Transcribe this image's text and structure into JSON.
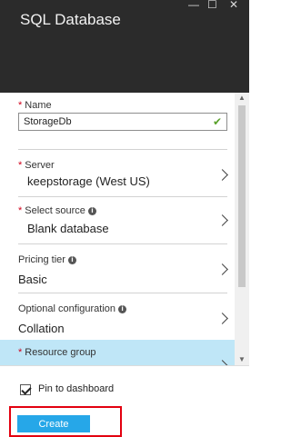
{
  "header": {
    "title": "SQL Database",
    "controls": {
      "minimize": "—",
      "maximize": "☐",
      "close": "✕"
    }
  },
  "form": {
    "name": {
      "label": "Name",
      "value": "StorageDb",
      "required": true
    },
    "server": {
      "label": "Server",
      "value": "keepstorage (West US)",
      "required": true
    },
    "select_source": {
      "label": "Select source",
      "value": "Blank database",
      "required": true
    },
    "pricing_tier": {
      "label": "Pricing tier",
      "value": "Basic",
      "required": false
    },
    "optional_configuration": {
      "label": "Optional configuration",
      "value": "Collation",
      "required": false
    },
    "resource_group": {
      "label": "Resource group",
      "required": true
    }
  },
  "footer": {
    "pin_label": "Pin to dashboard",
    "pin_checked": true,
    "create_label": "Create"
  },
  "colors": {
    "header_bg": "#2b2b2b",
    "required": "#d0021b",
    "highlight": "#bfe6f7",
    "create_button": "#26a7e8",
    "annotation_box": "#e3000f",
    "valid_check": "#5aa12b"
  },
  "icons": {
    "valid": "check-icon",
    "info": "info-icon",
    "row_arrow": "chevron-right-icon"
  }
}
